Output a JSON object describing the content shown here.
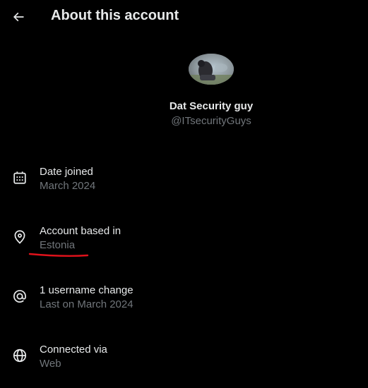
{
  "header": {
    "title": "About this account",
    "back_icon": "arrow-left-icon"
  },
  "profile": {
    "display_name": "Dat Security guy",
    "handle": "@ITsecurityGuys"
  },
  "details": [
    {
      "icon": "calendar-icon",
      "label": "Date joined",
      "value": "March 2024"
    },
    {
      "icon": "location-pin-icon",
      "label": "Account based in",
      "value": "Estonia"
    },
    {
      "icon": "at-sign-icon",
      "label": "1 username change",
      "value": "Last on March 2024"
    },
    {
      "icon": "globe-icon",
      "label": "Connected via",
      "value": "Web"
    }
  ],
  "colors": {
    "background": "#000000",
    "primary_text": "#e7e9ea",
    "secondary_text": "#71767b",
    "annotation_underline": "#e0121b"
  }
}
